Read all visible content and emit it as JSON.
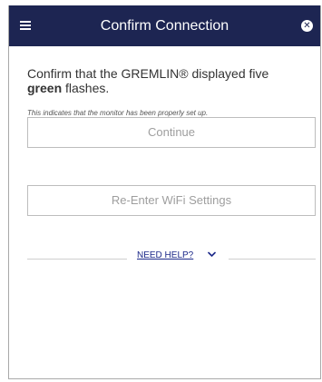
{
  "header": {
    "title": "Confirm Connection",
    "menu_icon": "hamburger-menu-icon",
    "close_icon": "close-circle-icon",
    "background_color": "#1d2552"
  },
  "content": {
    "prompt_prefix": "Confirm that the GREMLIN® displayed five",
    "prompt_emphasis": "green",
    "prompt_suffix": "flashes.",
    "note": "This indicates that the monitor has been properly set up."
  },
  "actions": {
    "continue_label": "Continue",
    "reenter_label": "Re-Enter WiFi Settings"
  },
  "help": {
    "label": "NEED HELP?",
    "icon": "chevron-down-icon",
    "link_color": "#1d2a8a"
  }
}
